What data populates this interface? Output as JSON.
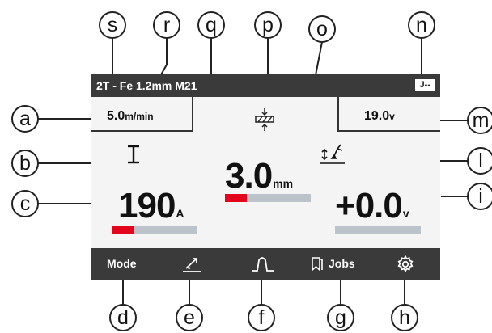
{
  "status_bar": {
    "program": "2T - Fe 1.2mm M21",
    "job_indicator": "J--"
  },
  "wire_speed": {
    "value": "5.0",
    "unit": "m/min"
  },
  "voltage_set": {
    "value": "19.0",
    "unit": "v"
  },
  "thickness": {
    "value": "3.0",
    "unit": "mm",
    "level": 0.25
  },
  "current": {
    "value": "190",
    "unit": "A",
    "level": 0.25
  },
  "voltage_correction": {
    "value": "+0.0",
    "unit": "v",
    "level": 0.0
  },
  "nav": {
    "mode_label": "Mode",
    "jobs_label": "Jobs"
  },
  "callouts": {
    "s": "s",
    "r": "r",
    "q": "q",
    "p": "p",
    "o": "o",
    "n": "n",
    "a": "a",
    "b": "b",
    "c": "c",
    "m": "m",
    "l": "l",
    "i": "i",
    "d": "d",
    "e": "e",
    "f": "f",
    "g": "g",
    "h": "h"
  },
  "colors": {
    "bar_fill": "#e3051b",
    "bar_track": "#bcc2c9",
    "dark_bar": "#3a3a3a",
    "screen_bg": "#f4f4f4"
  }
}
